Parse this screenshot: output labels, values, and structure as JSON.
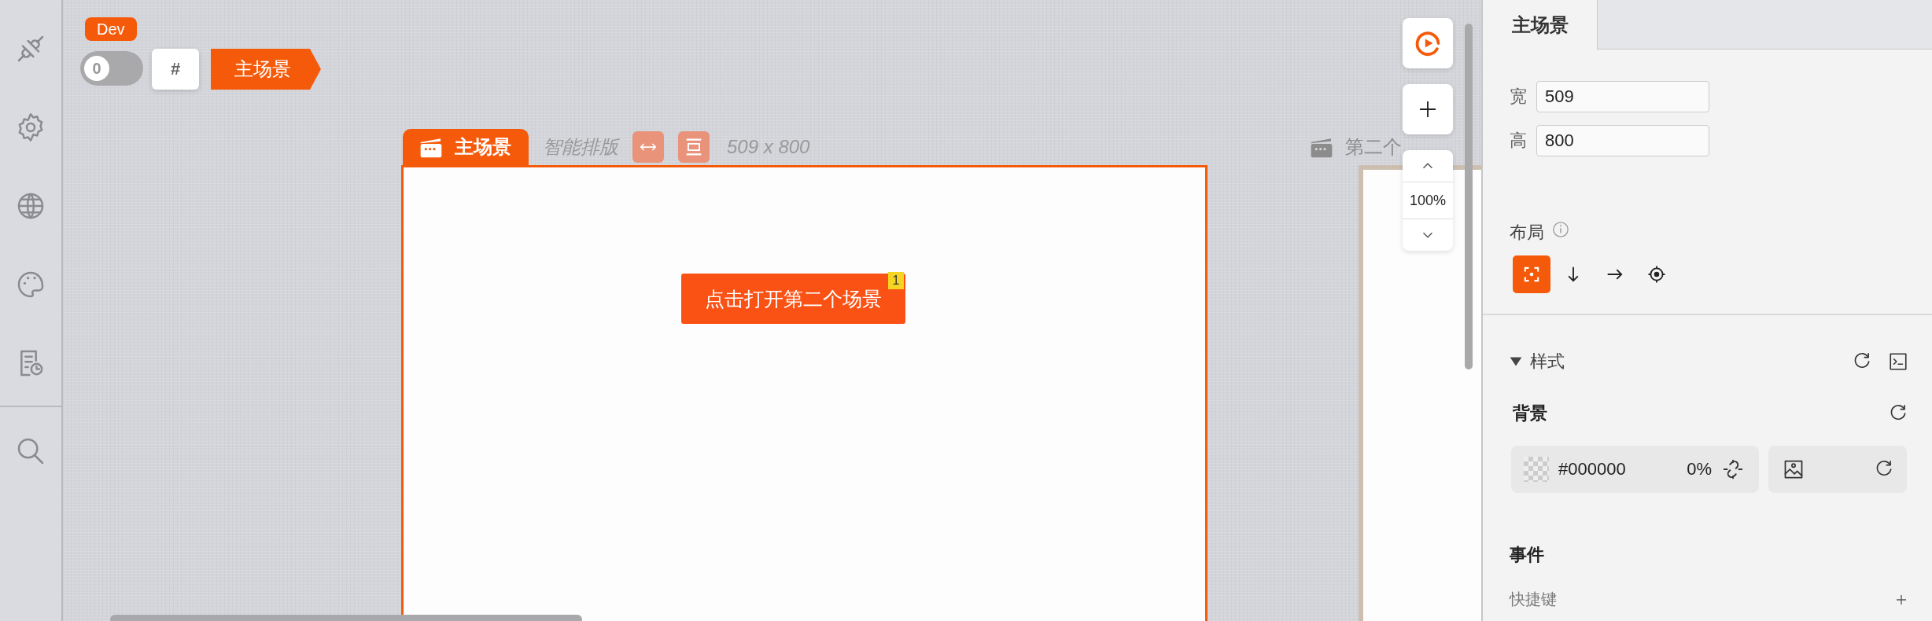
{
  "env_badge": "Dev",
  "toggle": {
    "label": "0",
    "on": false
  },
  "hash_button": "#",
  "breadcrumb": [
    {
      "label": "主场景"
    }
  ],
  "scenes": [
    {
      "title": "主场景",
      "layout_label": "智能排版",
      "size": "509 x 800",
      "active": true,
      "elements": [
        {
          "label": "点击打开第二个场景",
          "badge": "1"
        }
      ]
    },
    {
      "title": "第二个",
      "active": false
    }
  ],
  "zoom": {
    "reading": "100%"
  },
  "panel": {
    "tabs": [
      {
        "label": "主场景",
        "selected": true
      }
    ],
    "fields": [
      {
        "label": "宽",
        "value": "509"
      },
      {
        "label": "高",
        "value": "800"
      }
    ],
    "layout": {
      "label": "布局",
      "options": [
        {
          "kind": "free",
          "selected": true
        },
        {
          "kind": "vertical",
          "selected": false
        },
        {
          "kind": "horizontal",
          "selected": false
        },
        {
          "kind": "anchor",
          "selected": false
        }
      ]
    },
    "style_section": {
      "title": "样式",
      "expanded": true
    },
    "background": {
      "title": "背景",
      "hex_value": "#000000",
      "opacity": "0%"
    },
    "events_title": "事件",
    "shortcut_label": "快捷键"
  }
}
